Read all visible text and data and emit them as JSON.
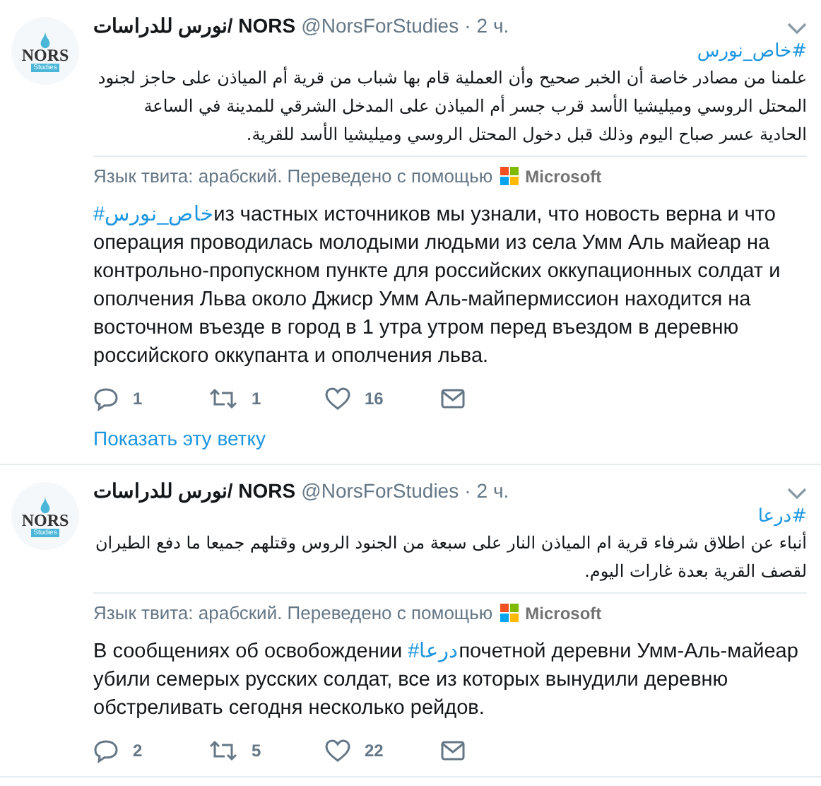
{
  "tweets": [
    {
      "author": "نورس للدراسات/ NORS",
      "handle": "@NorsForStudies",
      "separator": "·",
      "time": "2 ч.",
      "logo": {
        "title": "NORS",
        "subtitle": "Studies"
      },
      "hashtag": "#خاص_نورس",
      "text": "علمنا من مصادر خاصة أن الخبر صحيح وأن العملية قام بها شباب من قرية أم المياذن على حاجز لجنود المحتل الروسي وميليشيا الأسد قرب جسر أم المياذن على المدخل الشرقي للمدينة في الساعة الحادية عسر صباح اليوم وذلك قبل دخول المحتل الروسي وميليشيا الأسد للقرية.",
      "translation_note": "Язык твита: арабский. Переведено с помощью",
      "translator": "Microsoft",
      "translation": {
        "hashtag": "#خاص_نورس",
        "after": "из частных источников мы узнали, что новость верна и что операция проводилась молодыми людьми из села Умм Аль майеар на контрольно-пропускном пункте для российских оккупационных солдат и ополчения Льва около Джиср Умм Аль-майпермиссион находится на восточном въезде в город в 1 утра утром перед въездом в деревню российского оккупанта и ополчения льва."
      },
      "replies": "1",
      "retweets": "1",
      "likes": "16",
      "show_thread": "Показать эту ветку"
    },
    {
      "author": "نورس للدراسات/ NORS",
      "handle": "@NorsForStudies",
      "separator": "·",
      "time": "2 ч.",
      "logo": {
        "title": "NORS",
        "subtitle": "Studies"
      },
      "hashtag": "#درعا",
      "text": "أنباء عن اطلاق شرفاء قرية ام المياذن النار على سبعة من الجنود الروس وقتلهم جميعا ما دفع الطيران لقصف القرية بعدة غارات اليوم.",
      "translation_note": "Язык твита: арабский. Переведено с помощью",
      "translator": "Microsoft",
      "translation": {
        "before": "В сообщениях об освобождении ",
        "hashtag": "#درعا",
        "after": "почетной деревни Умм-Аль-майеар убили семерых русских солдат, все из которых вынудили деревню обстреливать сегодня несколько рейдов."
      },
      "replies": "2",
      "retweets": "5",
      "likes": "22"
    }
  ]
}
